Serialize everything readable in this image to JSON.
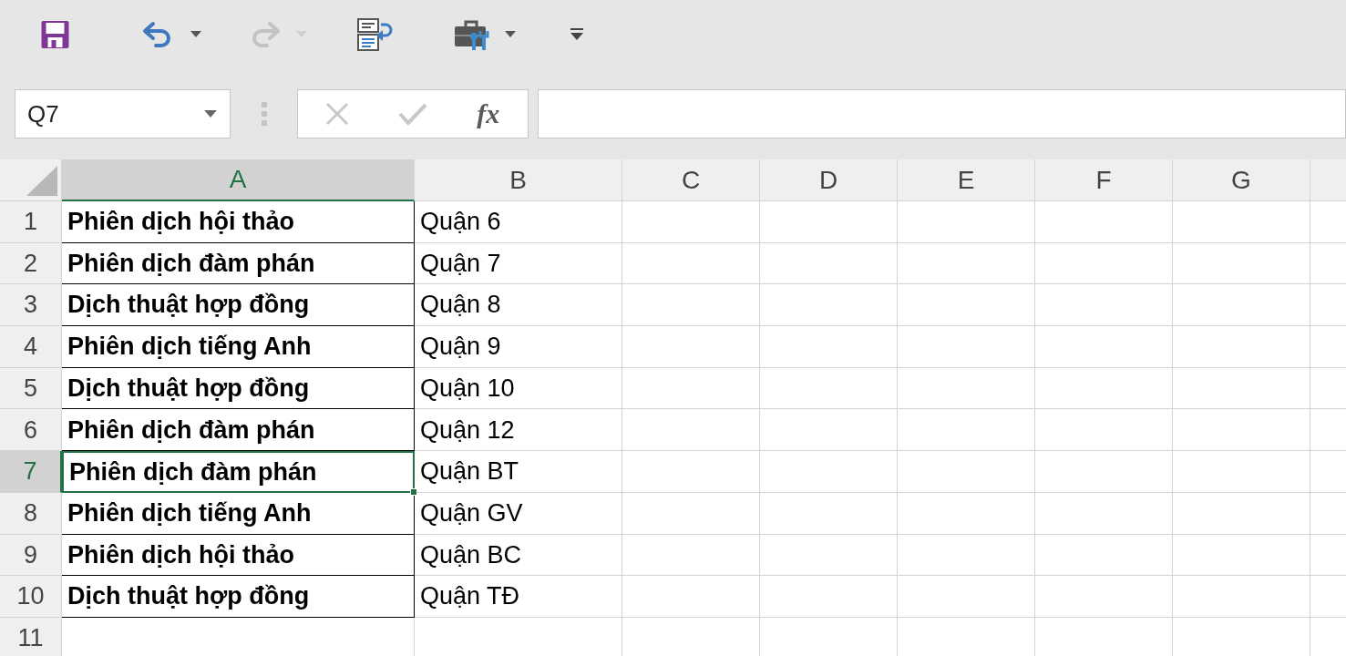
{
  "toolbar": {
    "items": [
      {
        "kind": "save",
        "disabled": false
      },
      {
        "kind": "undo",
        "disabled": false
      },
      {
        "kind": "redo",
        "disabled": true
      },
      {
        "kind": "form",
        "disabled": false
      },
      {
        "kind": "tools",
        "disabled": false
      },
      {
        "kind": "customize",
        "disabled": false
      }
    ]
  },
  "formula_bar": {
    "name_box": {
      "value": "Q7"
    },
    "buttons": [
      {
        "kind": "cancel",
        "disabled": true
      },
      {
        "kind": "enter",
        "disabled": true
      },
      {
        "kind": "function",
        "label": "fx",
        "disabled": false
      }
    ]
  },
  "sheet": {
    "columns": [
      {
        "label": "A",
        "selected": true
      },
      {
        "label": "B",
        "selected": false
      },
      {
        "label": "C",
        "selected": false
      },
      {
        "label": "D",
        "selected": false
      },
      {
        "label": "E",
        "selected": false
      },
      {
        "label": "F",
        "selected": false
      },
      {
        "label": "G",
        "selected": false
      }
    ],
    "rows": [
      {
        "number": "1",
        "selected": false,
        "cells": [
          {
            "text": "Phiên dịch hội thảo",
            "selected": false
          },
          {
            "text": "Quận 6",
            "selected": false
          }
        ]
      },
      {
        "number": "2",
        "selected": false,
        "cells": [
          {
            "text": "Phiên dịch đàm phán",
            "selected": false
          },
          {
            "text": "Quận 7",
            "selected": false
          }
        ]
      },
      {
        "number": "3",
        "selected": false,
        "cells": [
          {
            "text": "Dịch thuật hợp đồng",
            "selected": false
          },
          {
            "text": "Quận 8",
            "selected": false
          }
        ]
      },
      {
        "number": "4",
        "selected": false,
        "cells": [
          {
            "text": "Phiên dịch tiếng Anh",
            "selected": false
          },
          {
            "text": "Quận 9",
            "selected": false
          }
        ]
      },
      {
        "number": "5",
        "selected": false,
        "cells": [
          {
            "text": "Dịch thuật hợp đồng",
            "selected": false
          },
          {
            "text": "Quận 10",
            "selected": false
          }
        ]
      },
      {
        "number": "6",
        "selected": false,
        "cells": [
          {
            "text": "Phiên dịch đàm phán",
            "selected": false
          },
          {
            "text": "Quận 12",
            "selected": false
          }
        ]
      },
      {
        "number": "7",
        "selected": true,
        "cells": [
          {
            "text": "Phiên dịch đàm phán",
            "selected": true
          },
          {
            "text": "Quận BT",
            "selected": false
          }
        ]
      },
      {
        "number": "8",
        "selected": false,
        "cells": [
          {
            "text": "Phiên dịch tiếng Anh",
            "selected": false
          },
          {
            "text": "Quận GV",
            "selected": false
          }
        ]
      },
      {
        "number": "9",
        "selected": false,
        "cells": [
          {
            "text": "Phiên dịch hội thảo",
            "selected": false
          },
          {
            "text": "Quận BC",
            "selected": false
          }
        ]
      },
      {
        "number": "10",
        "selected": false,
        "cells": [
          {
            "text": "Dịch thuật hợp đồng",
            "selected": false
          },
          {
            "text": "Quận TĐ",
            "selected": false
          }
        ]
      },
      {
        "number": "11",
        "selected": false
      }
    ]
  }
}
